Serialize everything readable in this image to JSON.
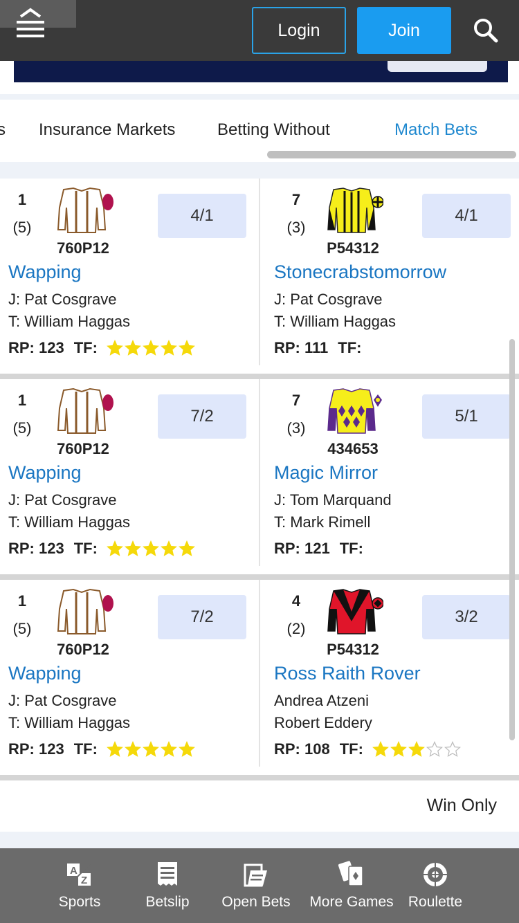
{
  "header": {
    "login_label": "Login",
    "join_label": "Join",
    "accent_color": "#1a9cf0"
  },
  "tabs": {
    "items": [
      {
        "label": "s"
      },
      {
        "label": "Insurance Markets"
      },
      {
        "label": "Betting Without"
      },
      {
        "label": "Match Bets",
        "active": true
      }
    ]
  },
  "matches": [
    {
      "left": {
        "number": "1",
        "draw": "(5)",
        "form": "760P12",
        "odds": "4/1",
        "name": "Wapping",
        "jockey": "J: Pat Cosgrave",
        "trainer": "T: William Haggas",
        "rp": "RP: 123",
        "tf": "TF:",
        "stars": 5,
        "silk": "brown-white"
      },
      "right": {
        "number": "7",
        "draw": "(3)",
        "form": "P54312",
        "odds": "4/1",
        "name": "Stonecrabstomorrow",
        "jockey": "J: Pat Cosgrave",
        "trainer": "T: William Haggas",
        "rp": "RP: 111",
        "tf": "TF:",
        "stars": 0,
        "silk": "yellow-black"
      }
    },
    {
      "left": {
        "number": "1",
        "draw": "(5)",
        "form": "760P12",
        "odds": "7/2",
        "name": "Wapping",
        "jockey": "J: Pat Cosgrave",
        "trainer": "T: William Haggas",
        "rp": "RP: 123",
        "tf": "TF:",
        "stars": 5,
        "silk": "brown-white"
      },
      "right": {
        "number": "7",
        "draw": "(3)",
        "form": "434653",
        "odds": "5/1",
        "name": "Magic Mirror",
        "jockey": "J: Tom Marquand",
        "trainer": "T: Mark Rimell",
        "rp": "RP: 121",
        "tf": "TF:",
        "stars": 0,
        "silk": "yellow-purple"
      }
    },
    {
      "left": {
        "number": "1",
        "draw": "(5)",
        "form": "760P12",
        "odds": "7/2",
        "name": "Wapping",
        "jockey": "J: Pat Cosgrave",
        "trainer": "T: William Haggas",
        "rp": "RP: 123",
        "tf": "TF:",
        "stars": 5,
        "silk": "brown-white"
      },
      "right": {
        "number": "4",
        "draw": "(2)",
        "form": "P54312",
        "odds": "3/2",
        "name": "Ross Raith Rover",
        "jockey": "Andrea Atzeni",
        "trainer": "Robert Eddery",
        "rp": "RP: 108",
        "tf": "TF:",
        "stars": 3,
        "silk": "red-black"
      }
    }
  ],
  "footer": {
    "win_only": "Win Only"
  },
  "bottom_nav": [
    {
      "label": "Sports",
      "icon": "az-icon"
    },
    {
      "label": "Betslip",
      "icon": "betslip-icon"
    },
    {
      "label": "Open Bets",
      "icon": "open-bets-icon"
    },
    {
      "label": "More Games",
      "icon": "cards-icon"
    },
    {
      "label": "Roulette",
      "icon": "roulette-icon"
    }
  ],
  "colors": {
    "link_blue": "#1a76c2",
    "odds_bg": "#dfe7fb",
    "star_yellow": "#f5d90a",
    "nav_bg": "#6b6b6b"
  }
}
